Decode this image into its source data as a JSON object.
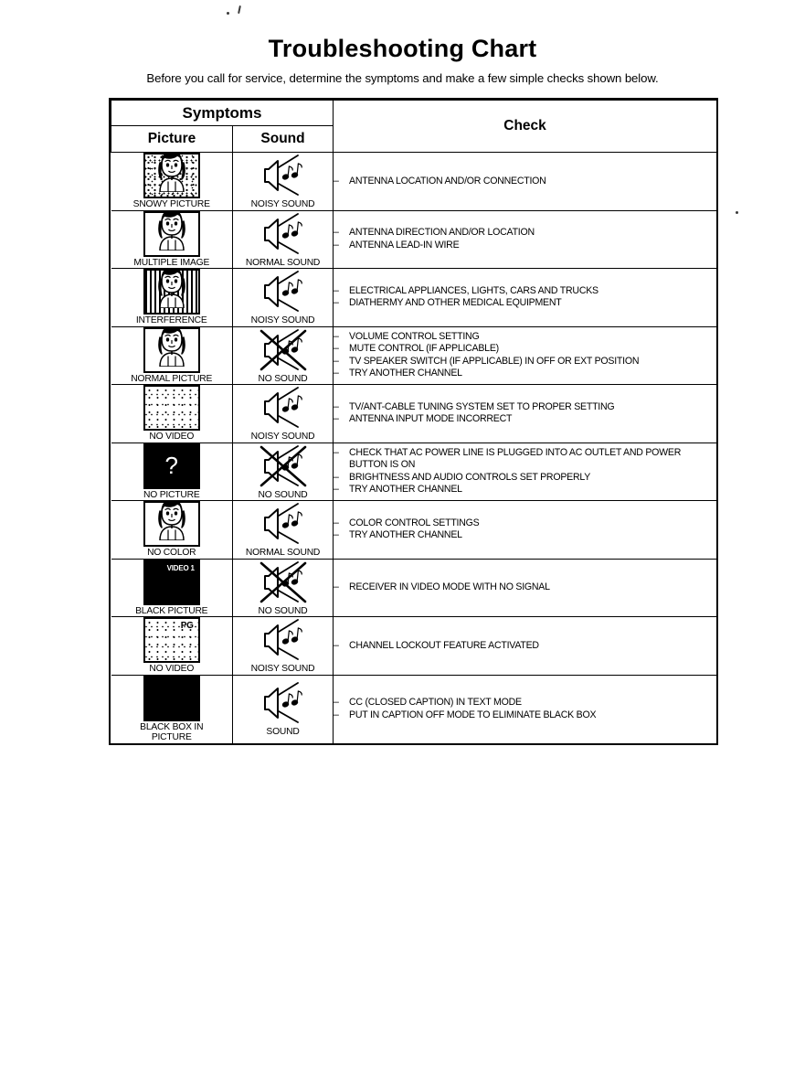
{
  "document": {
    "title": "Troubleshooting Chart",
    "intro": "Before you call for service, determine the symptoms and make a few simple checks shown below."
  },
  "table": {
    "header": {
      "symptoms": "Symptoms",
      "picture": "Picture",
      "sound": "Sound",
      "check": "Check"
    },
    "rows": [
      {
        "picture_caption": "SNOWY PICTURE",
        "picture_icon": "tv-snowy-face-icon",
        "sound_caption": "NOISY SOUND",
        "sound_icon": "speaker-noisy-icon",
        "checks": [
          "ANTENNA LOCATION AND/OR CONNECTION"
        ]
      },
      {
        "picture_caption": "MULTIPLE IMAGE",
        "picture_icon": "tv-ghosting-face-icon",
        "sound_caption": "NORMAL SOUND",
        "sound_icon": "speaker-normal-icon",
        "checks": [
          "ANTENNA DIRECTION AND/OR LOCATION",
          "ANTENNA LEAD-IN WIRE"
        ]
      },
      {
        "picture_caption": "INTERFERENCE",
        "picture_icon": "tv-interference-face-icon",
        "sound_caption": "NOISY SOUND",
        "sound_icon": "speaker-noisy-icon",
        "checks": [
          "ELECTRICAL APPLIANCES, LIGHTS, CARS AND TRUCKS",
          "DIATHERMY AND OTHER MEDICAL EQUIPMENT"
        ]
      },
      {
        "picture_caption": "NORMAL PICTURE",
        "picture_icon": "tv-normal-face-icon",
        "sound_caption": "NO SOUND",
        "sound_icon": "speaker-muted-icon",
        "checks": [
          "VOLUME CONTROL SETTING",
          "MUTE CONTROL (IF APPLICABLE)",
          "TV SPEAKER SWITCH (IF APPLICABLE) IN OFF OR EXT  POSITION",
          "TRY ANOTHER CHANNEL"
        ]
      },
      {
        "picture_caption": "NO VIDEO",
        "picture_icon": "tv-static-icon",
        "sound_caption": "NOISY SOUND",
        "sound_icon": "speaker-noisy-icon",
        "checks": [
          "TV/ANT-CABLE TUNING SYSTEM SET TO PROPER SETTING",
          "ANTENNA INPUT MODE INCORRECT"
        ]
      },
      {
        "picture_caption": "NO PICTURE",
        "picture_icon": "tv-question-mark-icon",
        "picture_badge": "?",
        "sound_caption": "NO SOUND",
        "sound_icon": "speaker-muted-icon",
        "checks": [
          "CHECK THAT AC POWER LINE  IS PLUGGED  INTO AC OUTLET AND POWER BUTTON IS ON",
          "BRIGHTNESS AND AUDIO CONTROLS SET PROPERLY",
          "TRY ANOTHER CHANNEL"
        ]
      },
      {
        "picture_caption": "NO COLOR",
        "picture_icon": "tv-monochrome-face-icon",
        "sound_caption": "NORMAL SOUND",
        "sound_icon": "speaker-normal-icon",
        "checks": [
          "COLOR CONTROL SETTINGS",
          "TRY ANOTHER CHANNEL"
        ]
      },
      {
        "picture_caption": "BLACK PICTURE",
        "picture_icon": "tv-black-video-input-icon",
        "picture_badge": "VIDEO 1",
        "sound_caption": "NO SOUND",
        "sound_icon": "speaker-muted-icon",
        "checks": [
          "RECEIVER IN VIDEO MODE WITH NO SIGNAL"
        ]
      },
      {
        "picture_caption": "NO VIDEO",
        "picture_icon": "tv-static-rating-icon",
        "picture_badge": "PG",
        "sound_caption": "NOISY SOUND",
        "sound_icon": "speaker-noisy-icon",
        "checks": [
          "CHANNEL LOCKOUT FEATURE ACTIVATED"
        ]
      },
      {
        "picture_caption": "BLACK BOX IN\nPICTURE",
        "picture_icon": "tv-black-box-icon",
        "sound_caption": "SOUND",
        "sound_icon": "speaker-normal-icon",
        "checks": [
          "CC (CLOSED CAPTION) IN TEXT MODE",
          "PUT IN CAPTION OFF MODE TO ELIMINATE BLACK BOX"
        ]
      }
    ]
  },
  "colors": {
    "ink": "#000000",
    "paper": "#ffffff"
  }
}
